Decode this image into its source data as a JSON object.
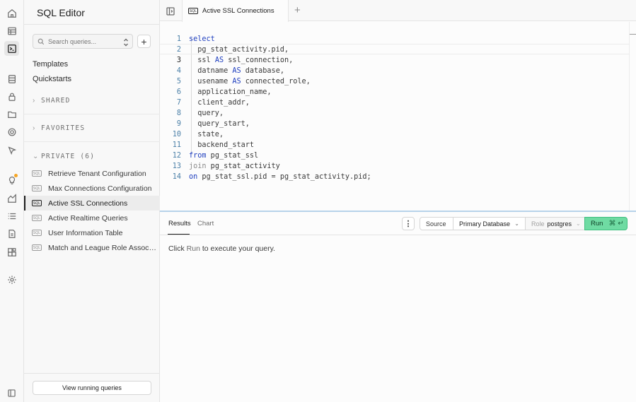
{
  "rail": {
    "icons": [
      "home-icon",
      "table-editor-icon",
      "sql-editor-icon",
      "database-icon",
      "auth-lock-icon",
      "storage-icon",
      "realtime-icon",
      "edge-functions-icon",
      "advisors-bulb-icon",
      "reports-icon",
      "logs-icon",
      "api-docs-icon",
      "integrations-icon",
      "settings-gear-icon",
      "collapse-sidebar-icon"
    ]
  },
  "sidebar": {
    "title": "SQL Editor",
    "search_placeholder": "Search queries...",
    "add_label": "+",
    "links": [
      "Templates",
      "Quickstarts"
    ],
    "sections": {
      "shared": "SHARED",
      "favorites": "FAVORITES",
      "private": "PRIVATE (6)"
    },
    "sql_badge": "SQL",
    "files": [
      "Retrieve Tenant Configuration",
      "Max Connections Configuration",
      "Active SSL Connections",
      "Active Realtime Queries",
      "User Information Table",
      "Match and League Role Associations"
    ],
    "active_file": "Active SSL Connections",
    "footer_button": "View running queries"
  },
  "tabs": {
    "active_tab": "Active SSL Connections",
    "add_label": "+"
  },
  "editor": {
    "line_numbers": [
      "1",
      "2",
      "3",
      "4",
      "5",
      "6",
      "7",
      "8",
      "9",
      "10",
      "11",
      "12",
      "13",
      "14"
    ],
    "current_line": 3,
    "lines": [
      "select",
      "  pg_stat_activity.pid,",
      "  ssl AS ssl_connection,",
      "  datname AS database,",
      "  usename AS connected_role,",
      "  application_name,",
      "  client_addr,",
      "  query,",
      "  query_start,",
      "  state,",
      "  backend_start",
      "from pg_stat_ssl",
      "join pg_stat_activity",
      "on pg_stat_ssl.pid = pg_stat_activity.pid;"
    ]
  },
  "results": {
    "tabs": [
      "Results",
      "Chart"
    ],
    "kebab": "⋮",
    "source_label": "Source",
    "database": "Primary Database",
    "role_label": "Role",
    "role_value": "postgres",
    "run_label": "Run",
    "run_shortcut": "⌘ ↵",
    "message_prefix": "Click",
    "message_run": "Run",
    "message_suffix": "to execute your query."
  },
  "colors": {
    "accent_run": "#6fdba3",
    "keyword": "#1f3fbf",
    "line_number": "#4a7fa7",
    "splitter": "#b7d3ea",
    "notification_dot": "#f5a524"
  }
}
